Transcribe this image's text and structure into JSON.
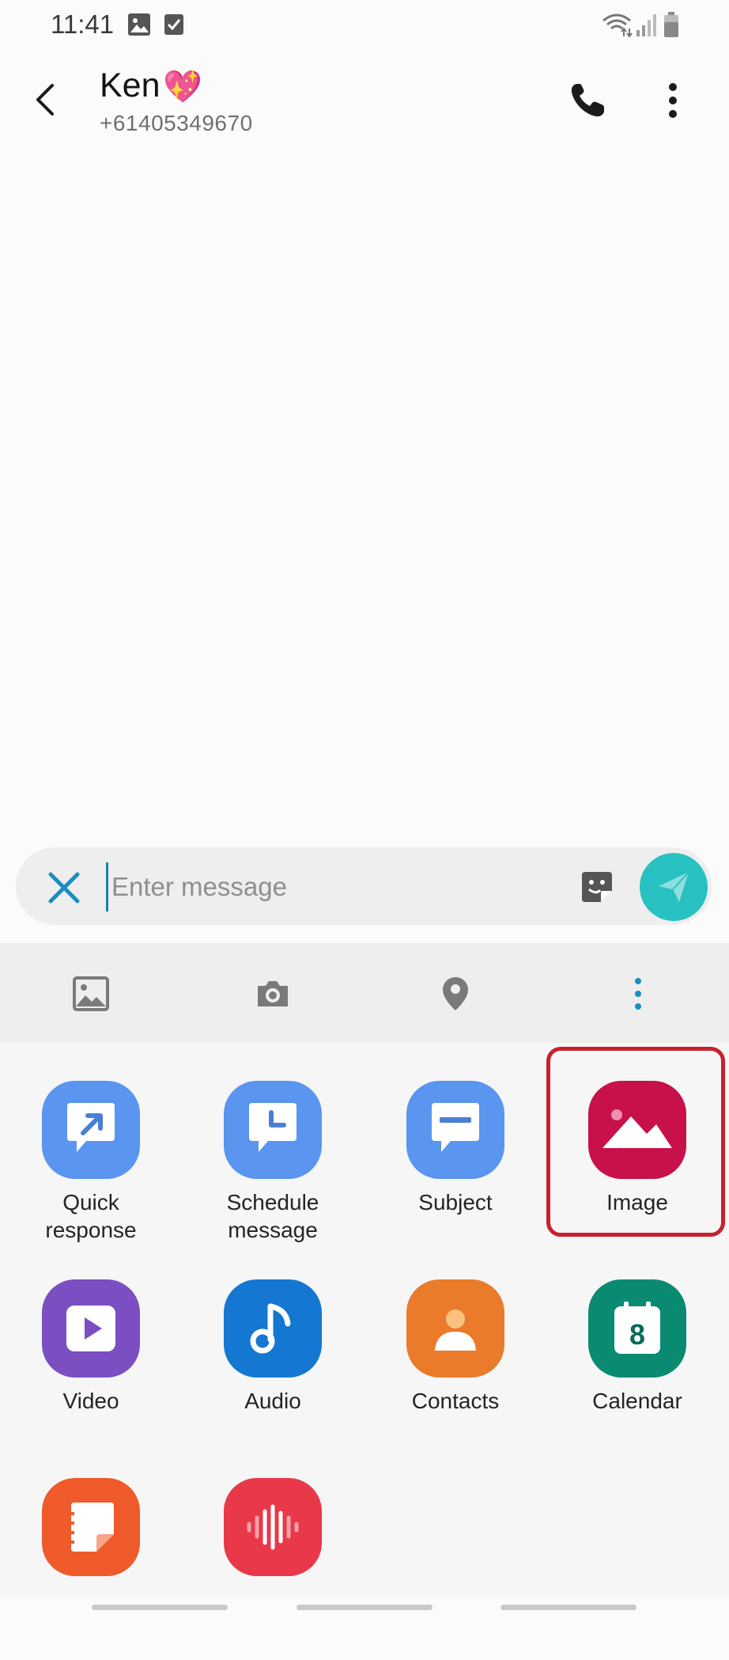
{
  "status_bar": {
    "time": "11:41"
  },
  "header": {
    "contact_name": "Ken",
    "contact_emoji": "💖",
    "contact_number": "+61405349670"
  },
  "compose": {
    "placeholder": "Enter message",
    "value": ""
  },
  "toolbar": {
    "items": [
      "gallery-icon",
      "camera-icon",
      "location-icon",
      "more-vertical-icon"
    ]
  },
  "attach_grid": {
    "items": [
      {
        "label": "Quick\nresponse",
        "icon": "quick-response-icon",
        "color": "#5a95ef"
      },
      {
        "label": "Schedule\nmessage",
        "icon": "schedule-message-icon",
        "color": "#5a95ef"
      },
      {
        "label": "Subject",
        "icon": "subject-icon",
        "color": "#5a95ef"
      },
      {
        "label": "Image",
        "icon": "image-icon",
        "color": "#c8104a"
      },
      {
        "label": "Video",
        "icon": "video-icon",
        "color": "#7b4ec1"
      },
      {
        "label": "Audio",
        "icon": "audio-icon",
        "color": "#1477d1"
      },
      {
        "label": "Contacts",
        "icon": "contacts-icon",
        "color": "#ea7b2a"
      },
      {
        "label": "Calendar",
        "icon": "calendar-icon",
        "color": "#0b8a72"
      },
      {
        "label": "",
        "icon": "notes-icon",
        "color": "#ef5a2a"
      },
      {
        "label": "",
        "icon": "voice-recorder-icon",
        "color": "#e8384a"
      }
    ],
    "calendar_day": "8"
  },
  "colors": {
    "accent": "#1a8fbf",
    "send": "#28c1c1",
    "highlight": "#c8202e"
  }
}
